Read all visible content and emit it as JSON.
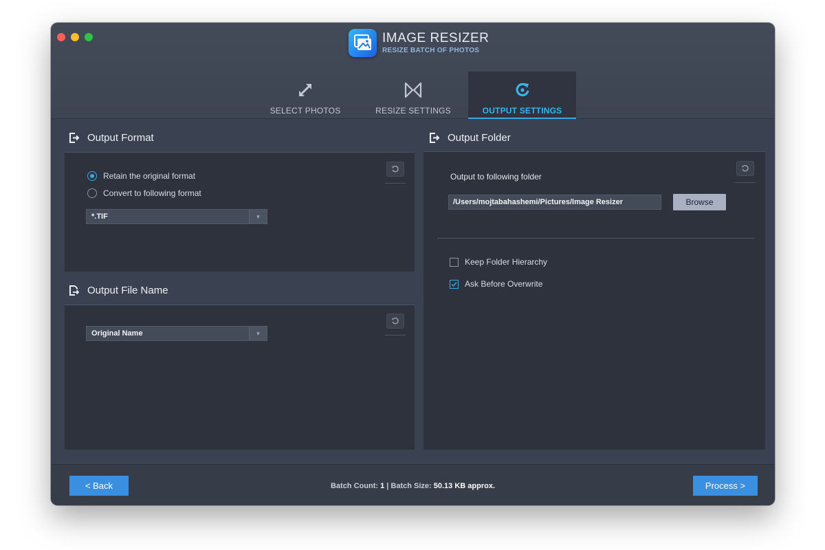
{
  "app": {
    "title": "IMAGE RESIZER",
    "subtitle": "RESIZE BATCH OF PHOTOS"
  },
  "tabs": [
    {
      "label": "SELECT PHOTOS",
      "icon": "expand-arrows-icon",
      "active": false
    },
    {
      "label": "RESIZE SETTINGS",
      "icon": "resize-bowtie-icon",
      "active": false
    },
    {
      "label": "OUTPUT SETTINGS",
      "icon": "output-refresh-icon",
      "active": true
    }
  ],
  "output_format": {
    "title": "Output Format",
    "options": [
      {
        "label": "Retain the original format",
        "selected": true
      },
      {
        "label": "Convert to  following format",
        "selected": false
      }
    ],
    "format_select": "*.TIF"
  },
  "output_file_name": {
    "title": "Output File Name",
    "name_select": "Original Name"
  },
  "output_folder": {
    "title": "Output Folder",
    "label": "Output to following folder",
    "path": "/Users/mojtabahashemi/Pictures/Image Resizer",
    "browse_label": "Browse",
    "options": [
      {
        "label": "Keep Folder Hierarchy",
        "checked": false
      },
      {
        "label": "Ask Before Overwrite",
        "checked": true
      }
    ]
  },
  "footer": {
    "back_label": "<   Back",
    "process_label": "Process   >",
    "batch_count_label": "Batch Count:",
    "batch_count_value": "1",
    "divider": "|",
    "batch_size_label": "Batch Size:",
    "batch_size_value": "50.13 KB approx."
  },
  "colors": {
    "accent": "#3aa8e8",
    "button_blue": "#3a8fe0",
    "window_bg": "#3a4150",
    "panel_bg": "#2d323d"
  }
}
